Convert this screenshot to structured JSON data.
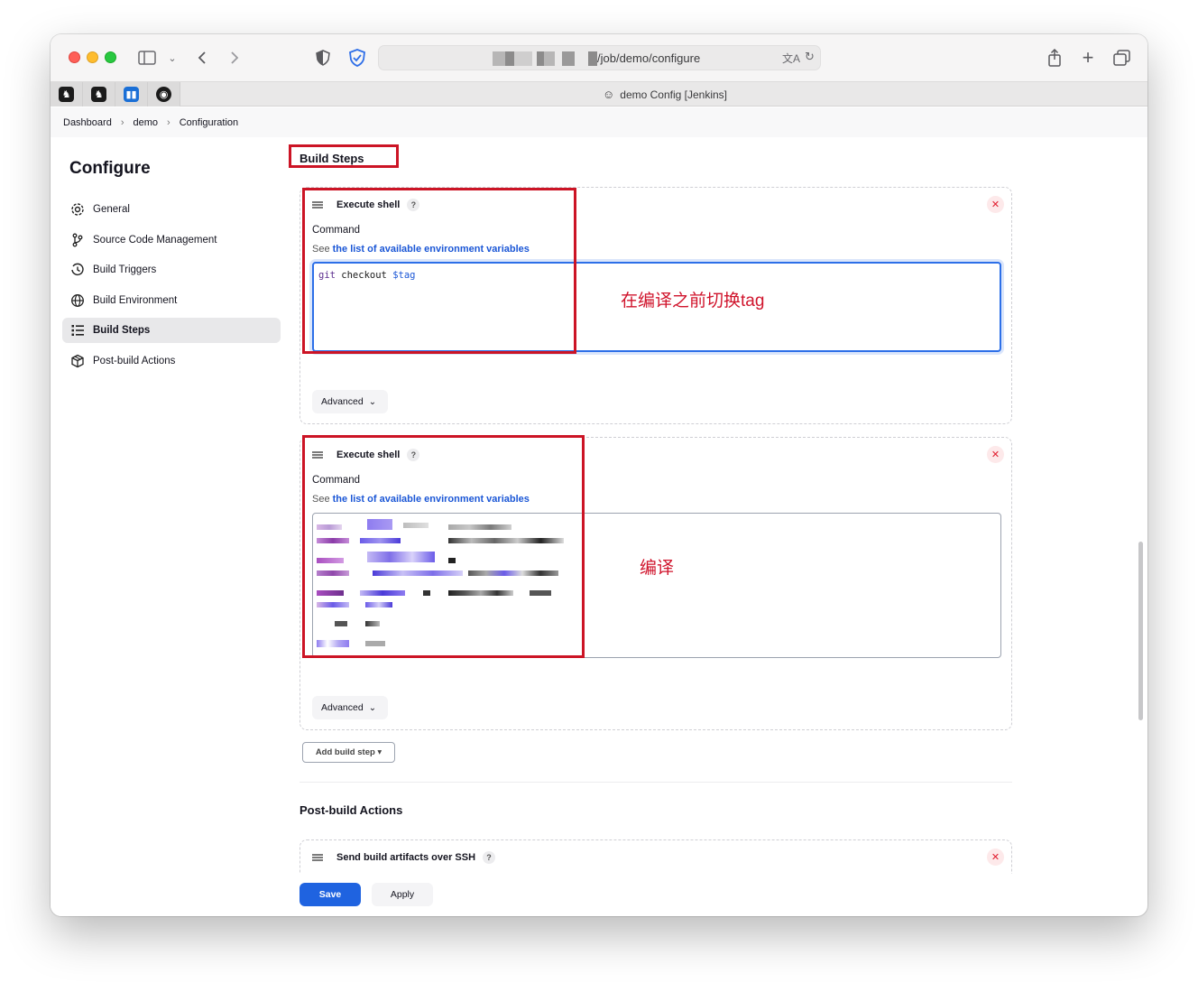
{
  "browser": {
    "url": "/job/demo/configure",
    "tab_title": "demo Config [Jenkins]"
  },
  "breadcrumb": [
    "Dashboard",
    "demo",
    "Configuration"
  ],
  "sidebar": {
    "title": "Configure",
    "items": [
      {
        "label": "General",
        "icon": "gear-icon"
      },
      {
        "label": "Source Code Management",
        "icon": "branch-icon"
      },
      {
        "label": "Build Triggers",
        "icon": "clock-icon"
      },
      {
        "label": "Build Environment",
        "icon": "globe-icon"
      },
      {
        "label": "Build Steps",
        "icon": "list-icon",
        "active": true
      },
      {
        "label": "Post-build Actions",
        "icon": "package-icon"
      }
    ]
  },
  "main": {
    "build_steps_title": "Build Steps",
    "steps": [
      {
        "title": "Execute shell",
        "help": "?",
        "command_label": "Command",
        "hint_prefix": "See ",
        "hint_link": "the list of available environment variables",
        "code_kw": "git",
        "code_text": " checkout ",
        "code_var": "$tag",
        "advanced": "Advanced",
        "annotation": "在编译之前切换tag"
      },
      {
        "title": "Execute shell",
        "help": "?",
        "command_label": "Command",
        "hint_prefix": "See ",
        "hint_link": "the list of available environment variables",
        "advanced": "Advanced",
        "annotation": "编译"
      }
    ],
    "add_build_step": "Add build step ▾",
    "post_build_title": "Post-build Actions",
    "post_build_step": {
      "title": "Send build artifacts over SSH",
      "help": "?"
    },
    "save": "Save",
    "apply": "Apply"
  },
  "colors": {
    "accent": "#1f63e0",
    "annotation": "#d0142c",
    "link": "#1a56d6"
  }
}
